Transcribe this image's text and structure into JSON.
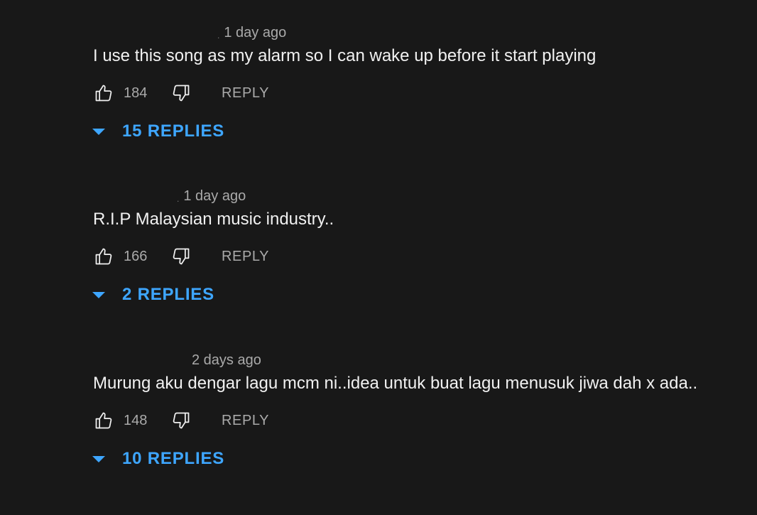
{
  "comments": [
    {
      "dot": ".",
      "time": "1 day ago",
      "text": "I use this song as my alarm so I can wake up before it start playing",
      "likes": "184",
      "reply_label": "REPLY",
      "replies_label": "15 REPLIES"
    },
    {
      "dot": ".",
      "time": "1 day ago",
      "text": "R.I.P Malaysian music industry..",
      "likes": "166",
      "reply_label": "REPLY",
      "replies_label": "2 REPLIES"
    },
    {
      "dot": "",
      "time": "2 days ago",
      "text": "Murung aku dengar lagu mcm ni..idea untuk buat lagu menusuk jiwa dah x ada..",
      "likes": "148",
      "reply_label": "REPLY",
      "replies_label": "10 REPLIES"
    }
  ],
  "icons": {
    "like": "thumb-up-icon",
    "dislike": "thumb-down-icon",
    "expand": "caret-down-icon"
  },
  "colors": {
    "background": "#181818",
    "text": "#f1f1f1",
    "secondary": "#aaaaaa",
    "accent": "#3ea6ff"
  }
}
